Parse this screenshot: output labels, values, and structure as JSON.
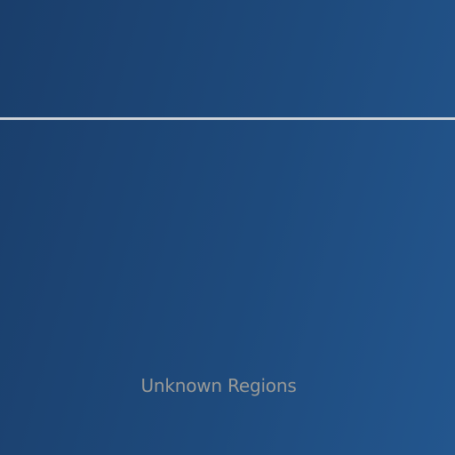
{
  "region": {
    "label": "Unknown Regions"
  },
  "colors": {
    "background_start": "#1a3e6b",
    "background_end": "#23568e",
    "divider": "#cfd3d8",
    "label": "#9a9b98"
  }
}
